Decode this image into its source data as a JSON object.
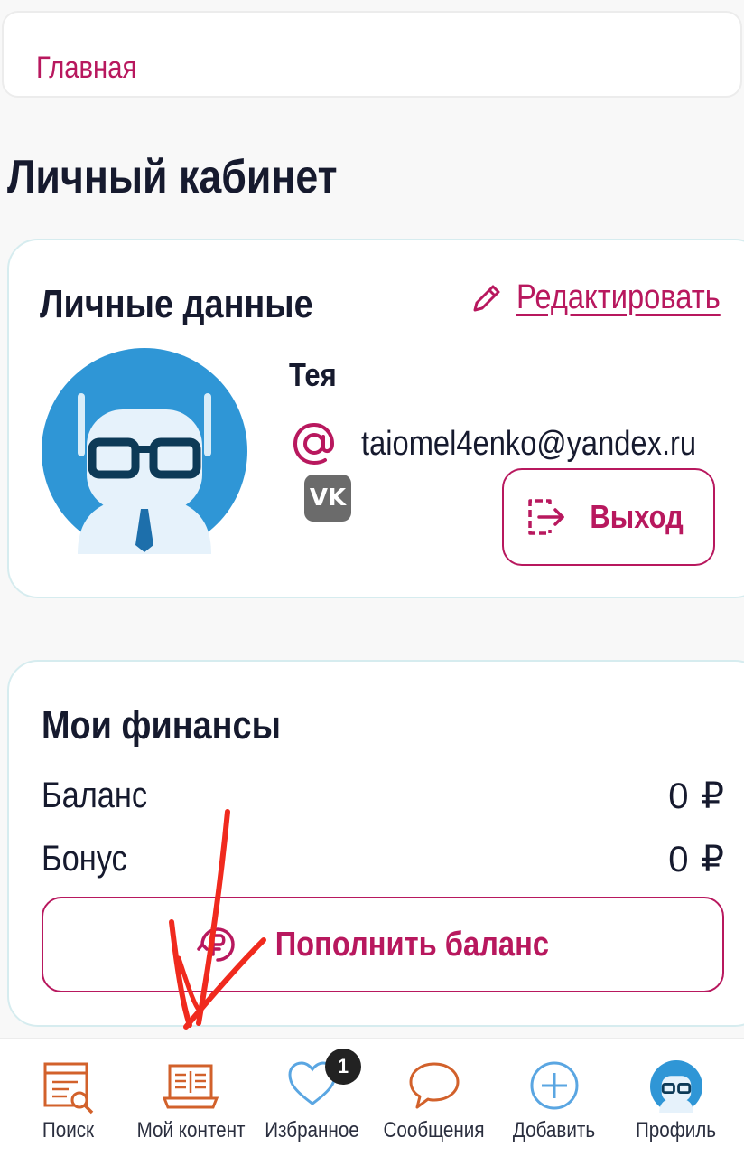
{
  "breadcrumb": {
    "home": "Главная"
  },
  "page": {
    "title": "Личный кабинет"
  },
  "personal": {
    "title": "Личные данные",
    "edit_label": "Редактировать",
    "name": "Тея",
    "email": "taiomel4enko@yandex.ru",
    "vk_label": "VK",
    "logout_label": "Выход"
  },
  "finances": {
    "title": "Мои финансы",
    "balance_label": "Баланс",
    "balance_value": "0",
    "bonus_label": "Бонус",
    "bonus_value": "0",
    "currency": "₽",
    "topup_label": "Пополнить баланс"
  },
  "tabbar": {
    "search": "Поиск",
    "my_content": "Мой контент",
    "favorites": "Избранное",
    "favorites_badge": "1",
    "messages": "Сообщения",
    "add": "Добавить",
    "profile": "Профиль"
  },
  "colors": {
    "accent": "#b8185e",
    "tab_icon_orange": "#d2612b",
    "tab_icon_blue": "#5aa6e2",
    "annotation_red": "#f02a1e"
  }
}
